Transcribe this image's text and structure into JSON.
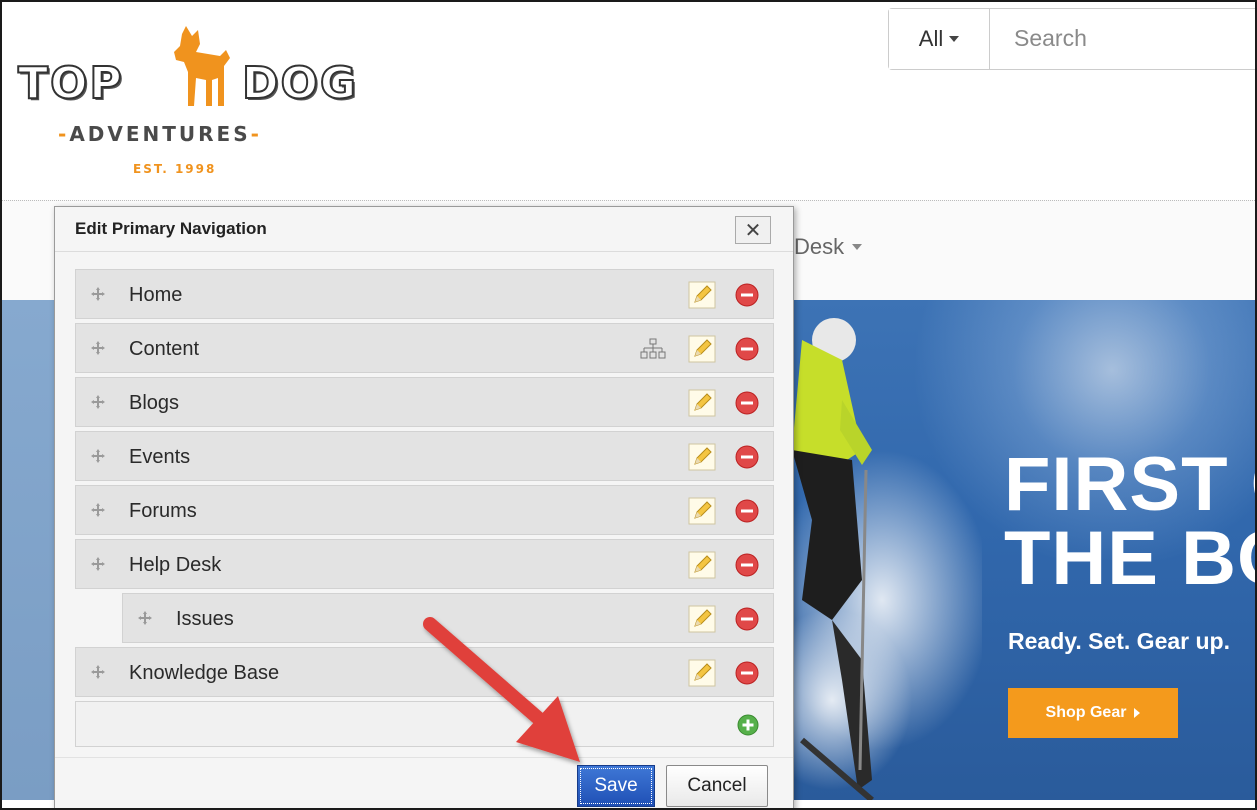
{
  "site": {
    "logo": {
      "top": "TOP",
      "dog": "DOG",
      "adventures": "ADVENTURES",
      "est": "EST. 1998"
    },
    "search": {
      "scope_label": "All",
      "placeholder": "Search"
    },
    "nav_partial_label": "Desk",
    "hero": {
      "title_line1": "FIRST C",
      "title_line2": "THE BO",
      "subtitle": "Ready. Set. Gear up.",
      "cta_label": "Shop Gear"
    }
  },
  "modal": {
    "title": "Edit Primary Navigation",
    "close_label": "✕",
    "items": [
      {
        "label": "Home"
      },
      {
        "label": "Content"
      },
      {
        "label": "Blogs"
      },
      {
        "label": "Events"
      },
      {
        "label": "Forums"
      },
      {
        "label": "Help Desk"
      },
      {
        "label": "Issues"
      },
      {
        "label": "Knowledge Base"
      }
    ],
    "save_label": "Save",
    "cancel_label": "Cancel"
  },
  "colors": {
    "accent_orange": "#f0931e",
    "save_blue": "#2a5fc4",
    "delete_red": "#e04848",
    "add_green": "#56b04a",
    "hero_blue": "#3168ad",
    "arrow_red": "#e0403a"
  },
  "icons": {
    "drag": "move-handle-icon",
    "edit": "pencil-icon",
    "delete": "minus-circle-icon",
    "tree": "sitemap-icon",
    "add": "plus-circle-icon"
  }
}
